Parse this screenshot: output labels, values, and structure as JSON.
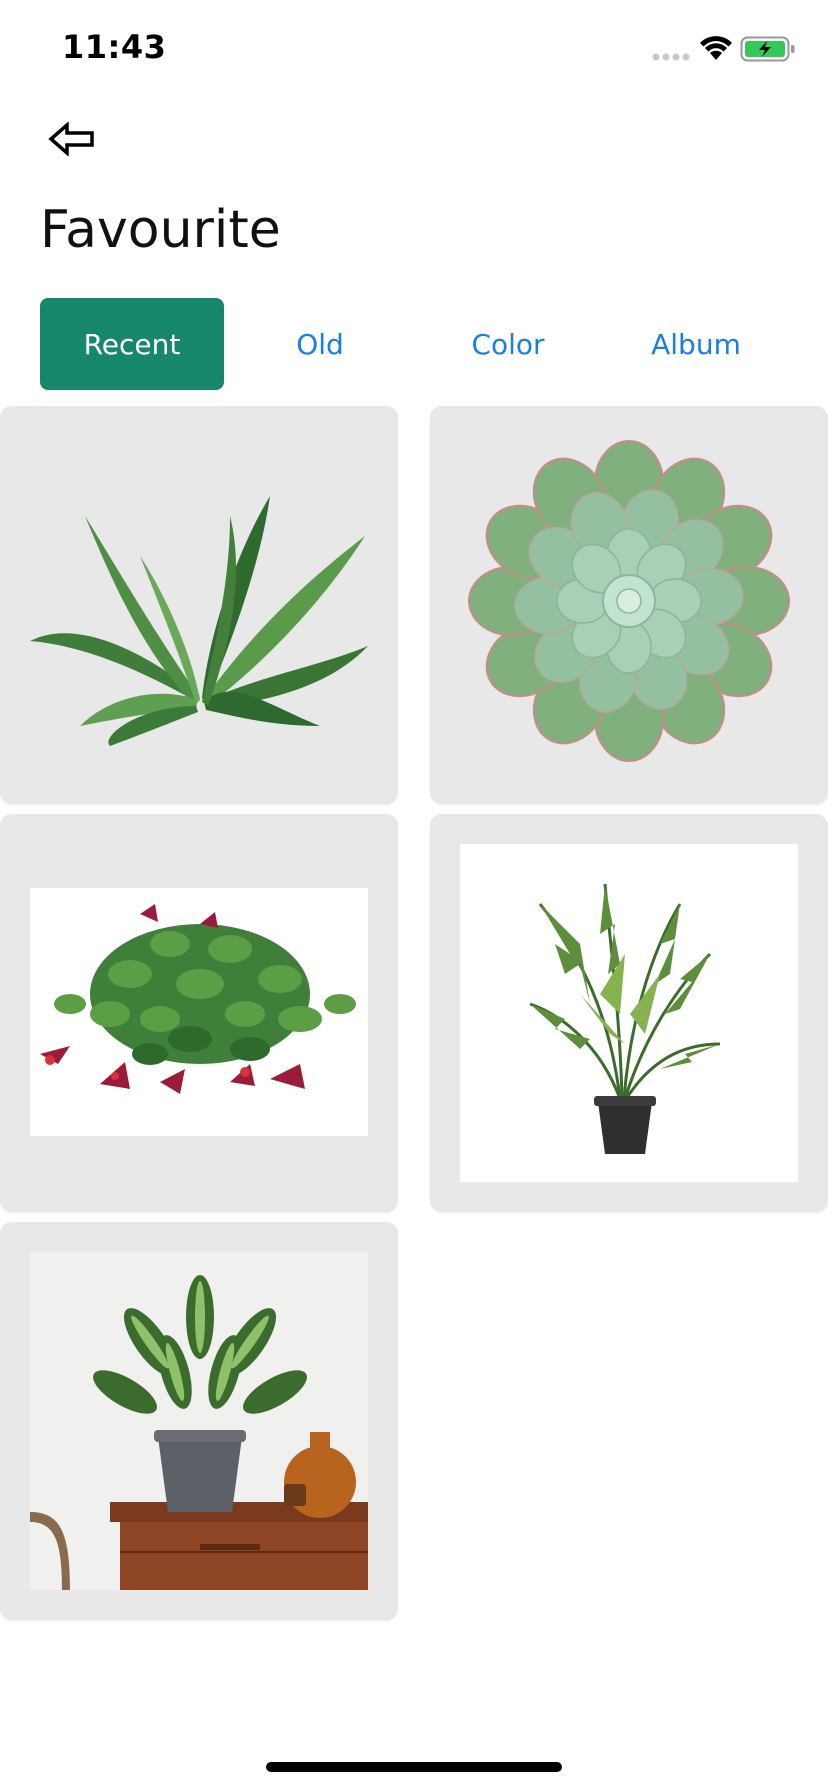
{
  "status_bar": {
    "time": "11:43",
    "icons": [
      "cellular-signal-icon",
      "wifi-icon",
      "battery-charging-icon"
    ],
    "battery_color": "#34c759"
  },
  "header": {
    "back_icon": "back-arrow-icon",
    "title": "Favourite"
  },
  "tabs": [
    {
      "label": "Recent",
      "active": true
    },
    {
      "label": "Old",
      "active": false
    },
    {
      "label": "Color",
      "active": false
    },
    {
      "label": "Album",
      "active": false
    }
  ],
  "colors": {
    "accent": "#16876b",
    "tab_text": "#1a7ee6",
    "card_background": "#e8e8e8"
  },
  "gallery": {
    "items": [
      {
        "icon": "birds-nest-fern-image"
      },
      {
        "icon": "echeveria-succulent-image"
      },
      {
        "icon": "flowering-vine-plant-image"
      },
      {
        "icon": "kentia-palm-image"
      },
      {
        "icon": "calathea-on-dresser-image"
      }
    ]
  }
}
